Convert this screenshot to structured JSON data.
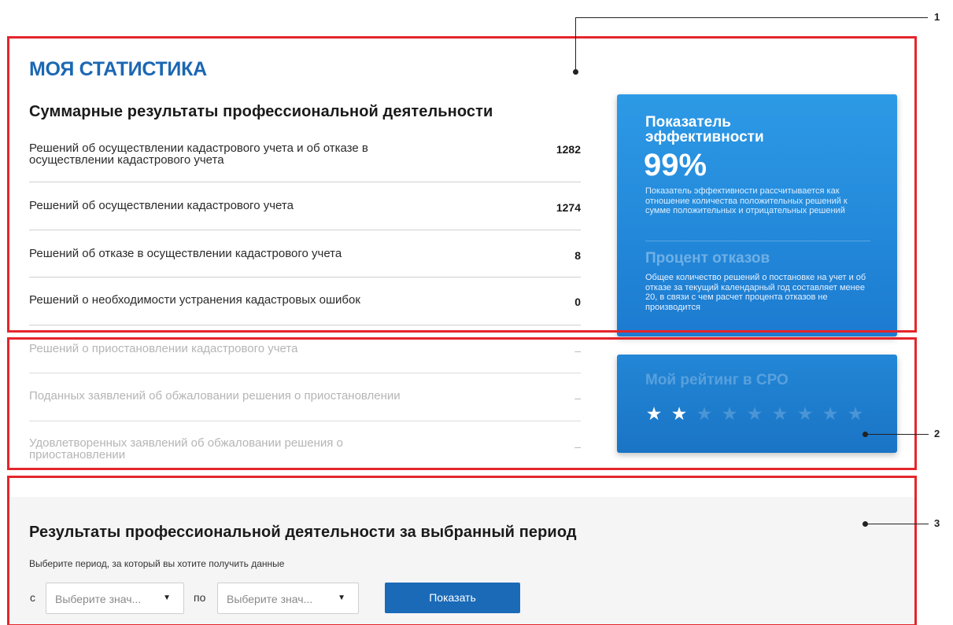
{
  "header": {
    "title": "МОЯ СТАТИСТИКА",
    "summary_title": "Суммарные результаты профессиональной деятельности"
  },
  "stats": [
    {
      "label": "Решений об осуществлении кадастрового учета и об отказе в осуществлении кадастрового учета",
      "value": "1282"
    },
    {
      "label": "Решений об осуществлении кадастрового учета",
      "value": "1274"
    },
    {
      "label": "Решений об отказе в осуществлении кадастрового учета",
      "value": "8"
    },
    {
      "label": "Решений о необходимости устранения кадастровых ошибок",
      "value": "0"
    },
    {
      "label": "Решений о приостановлении кадастрового учета",
      "value": "–"
    },
    {
      "label": "Поданных заявлений об обжаловании решения о приостановлении",
      "value": "–"
    },
    {
      "label": "Удовлетворенных заявлений об обжаловании решения о приостановлении",
      "value": "–"
    }
  ],
  "efficiency": {
    "title": "Показатель эффективности",
    "value": "99%",
    "description": "Показатель эффективности рассчитывается как отношение количества положительных решений к сумме положительных и отрицательных решений",
    "refusal_title": "Процент отказов",
    "refusal_description": "Общее количество решений о постановке на учет и об отказе за текущий календарный год составляет менее 20, в связи с чем расчет процента отказов не производится"
  },
  "rating": {
    "title": "Мой рейтинг в СРО",
    "stars_filled": 2,
    "stars_total": 9
  },
  "period": {
    "title": "Результаты профессиональной деятельности за выбранный период",
    "hint": "Выберите период, за который вы хотите получить данные",
    "from_label": "с",
    "to_label": "по",
    "from_placeholder": "Выберите знач...",
    "to_placeholder": "Выберите знач...",
    "button_label": "Показать"
  },
  "callouts": [
    "1",
    "2",
    "3"
  ],
  "colors": {
    "accent": "#1b67b3",
    "card_blue": "#1c7bd0",
    "frame_red": "#e4262c",
    "button_blue": "#1a6ab8"
  },
  "icons": {
    "star": "star-icon",
    "caret": "caret-down-icon"
  }
}
